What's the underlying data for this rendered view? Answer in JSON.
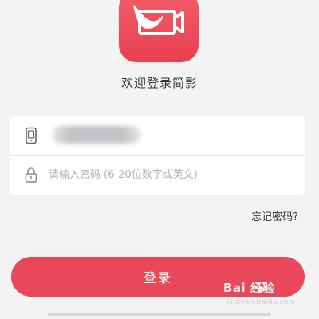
{
  "app": {
    "icon_name": "jianying-dove-icon",
    "welcome_text": "欢迎登录简影",
    "brand_color": "#e8485a"
  },
  "login_form": {
    "phone_icon": "phone-icon",
    "phone_value_hidden": true,
    "password_icon": "lock-icon",
    "password_placeholder": "请输入密码 (6-20位数字或英文)"
  },
  "links": {
    "forgot_password": "忘记密码?"
  },
  "actions": {
    "login_label": "登录"
  },
  "watermark": {
    "main": "Bai 经验",
    "sub": "jingyan.baidu.com"
  }
}
